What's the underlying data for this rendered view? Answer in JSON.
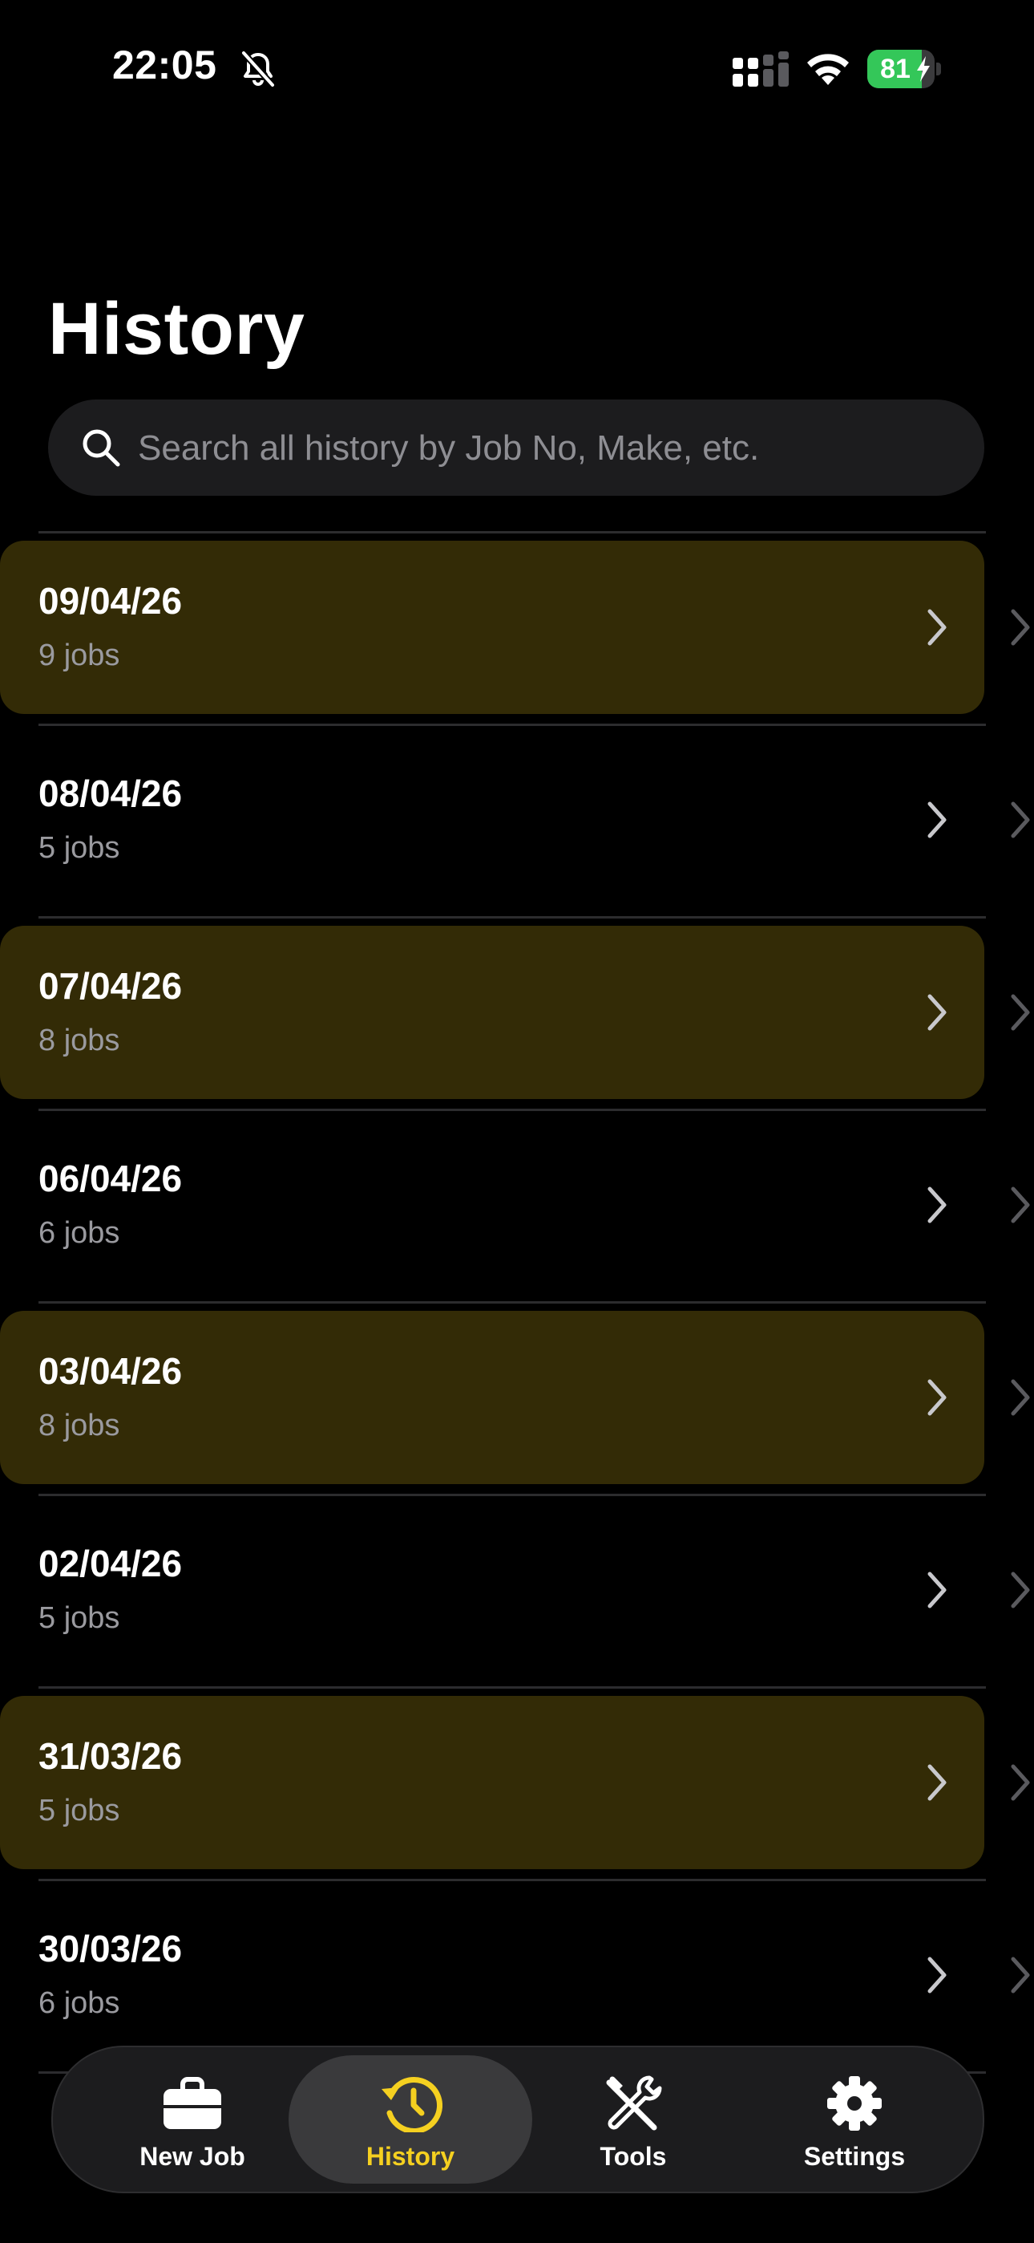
{
  "status_bar": {
    "time": "22:05",
    "battery_percent": "81",
    "battery_level": 0.81,
    "icons": [
      "bell-slash-icon",
      "cellular-signal-icon",
      "wifi-icon",
      "battery-charging-icon"
    ]
  },
  "header": {
    "title": "History"
  },
  "search": {
    "placeholder": "Search all history by Job No, Make, etc.",
    "value": ""
  },
  "history": [
    {
      "date": "09/04/26",
      "count": "9 jobs",
      "highlighted": true
    },
    {
      "date": "08/04/26",
      "count": "5 jobs",
      "highlighted": false
    },
    {
      "date": "07/04/26",
      "count": "8 jobs",
      "highlighted": true
    },
    {
      "date": "06/04/26",
      "count": "6 jobs",
      "highlighted": false
    },
    {
      "date": "03/04/26",
      "count": "8 jobs",
      "highlighted": true
    },
    {
      "date": "02/04/26",
      "count": "5 jobs",
      "highlighted": false
    },
    {
      "date": "31/03/26",
      "count": "5 jobs",
      "highlighted": true
    },
    {
      "date": "30/03/26",
      "count": "6 jobs",
      "highlighted": false
    }
  ],
  "tabbar": {
    "tabs": [
      {
        "label": "New Job",
        "icon": "briefcase-icon",
        "active": false
      },
      {
        "label": "History",
        "icon": "clock-history-icon",
        "active": true
      },
      {
        "label": "Tools",
        "icon": "tools-icon",
        "active": false
      },
      {
        "label": "Settings",
        "icon": "gear-icon",
        "active": false
      }
    ]
  },
  "colors": {
    "background": "#000000",
    "highlight_row": "#332b06",
    "accent": "#f5d020",
    "battery": "#34c759",
    "secondary_text": "#9a9a9f"
  }
}
